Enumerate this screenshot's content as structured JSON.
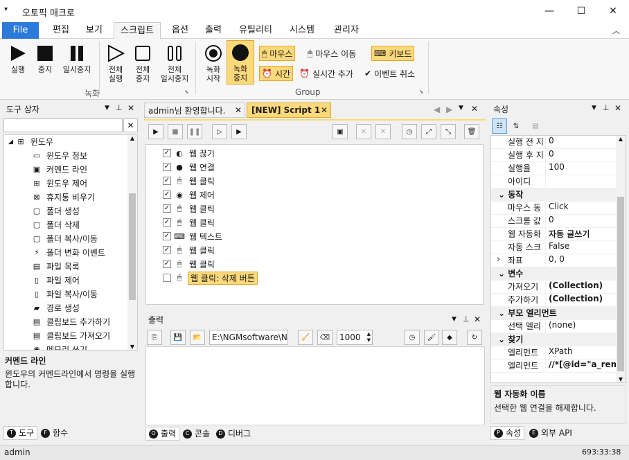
{
  "window": {
    "title": "오토픽 매크로",
    "minimize": "—",
    "maximize": "☐",
    "close": "✕"
  },
  "menu": {
    "tabs": [
      "File",
      "편집",
      "보기",
      "스크립트",
      "옵션",
      "출력",
      "유틸리티",
      "시스템",
      "관리자"
    ],
    "active": "스크립트"
  },
  "ribbon": {
    "rec_group": {
      "label": "녹화",
      "buttons": [
        "실행",
        "중지",
        "일시중지",
        "전체\n실행",
        "전체\n중지",
        "전체\n일시중지"
      ]
    },
    "group2": {
      "label": "Group",
      "rec_start": "녹화\n시작",
      "rec_stop": "녹화\n중지",
      "small": {
        "mouse": "마우스",
        "mouse_move": "마우스 이동",
        "keyboard": "키보드",
        "time": "시간",
        "realtime_add": "실시간 추가",
        "event_cancel": "이벤트 취소"
      }
    }
  },
  "toolbox": {
    "title": "도구 상자",
    "search_placeholder": "",
    "root": "윈도우",
    "items": [
      "윈도우 정보",
      "커멘드 라인",
      "윈도우 제어",
      "휴지통 비우기",
      "폴더 생성",
      "폴더 삭제",
      "폴더 복사/이동",
      "폴더 변화 이벤트",
      "파일 목록",
      "파일 제어",
      "파일 복사/이동",
      "경로 생성",
      "클립보드 추가하기",
      "클립보드 가져오기",
      "메모리 쓰기"
    ],
    "desc_title": "커멘드 라인",
    "desc_text": "윈도우의 커멘드라인에서 명령을 실행합니다.",
    "tabs": [
      "도구",
      "함수"
    ]
  },
  "editor": {
    "tabs": [
      "admin님 환영합니다.",
      "[NEW] Script 1"
    ],
    "rows": [
      {
        "label": "웹 끊기",
        "checked": true
      },
      {
        "label": "웹 연결",
        "checked": true
      },
      {
        "label": "웹 클릭",
        "checked": true
      },
      {
        "label": "웹 제어",
        "checked": true
      },
      {
        "label": "웹 클릭",
        "checked": true
      },
      {
        "label": "웹 클릭",
        "checked": true
      },
      {
        "label": "웹 텍스트",
        "checked": true
      },
      {
        "label": "웹 클릭",
        "checked": true
      },
      {
        "label": "웹 클릭",
        "checked": true
      },
      {
        "label": "웹 클릭: 삭제 버튼",
        "checked": false
      }
    ]
  },
  "output": {
    "title": "출력",
    "path": "E:\\NGMsoftware\\NG",
    "count": "1000",
    "tabs": [
      "출력",
      "콘솔",
      "디버그"
    ]
  },
  "properties": {
    "title": "속성",
    "rows_top": [
      {
        "k": "실행 전 지",
        "v": "0"
      },
      {
        "k": "실행 후 지",
        "v": "0"
      },
      {
        "k": "실행율",
        "v": "100"
      },
      {
        "k": "아이디",
        "v": ""
      }
    ],
    "cat_action": "동작",
    "rows_action": [
      {
        "k": "마우스 동",
        "v": "Click"
      },
      {
        "k": "스크롤 값",
        "v": "0"
      },
      {
        "k": "웹 자동화",
        "v": "자동 글쓰기"
      },
      {
        "k": "자동 스크",
        "v": "False"
      },
      {
        "k": "좌표",
        "v": "0, 0"
      }
    ],
    "cat_var": "변수",
    "rows_var": [
      {
        "k": "가져오기",
        "v": "(Collection)"
      },
      {
        "k": "추가하기",
        "v": "(Collection)"
      }
    ],
    "cat_parent": "부모 엘리먼트",
    "rows_parent": [
      {
        "k": "선택 엘리",
        "v": "(none)"
      }
    ],
    "cat_find": "찾기",
    "rows_find": [
      {
        "k": "엘리먼트",
        "v": "XPath"
      },
      {
        "k": "엘리먼트",
        "v": "//*[@id=\"a_remo"
      }
    ],
    "desc_title": "웹 자동화 이름",
    "desc_text": "선택한 웹 연결을 해제합니다.",
    "tabs": [
      "속성",
      "외부 API"
    ]
  },
  "status": {
    "user": "admin",
    "time": "693:33:38"
  }
}
